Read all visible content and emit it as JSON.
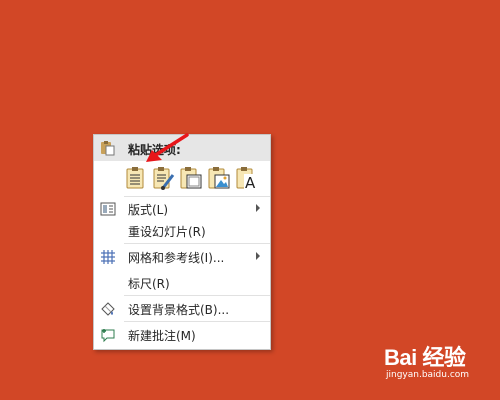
{
  "context_menu": {
    "paste_options_label": "粘贴选项:",
    "paste_options": [
      {
        "icon": "paste-destination-theme-icon"
      },
      {
        "icon": "paste-keep-formatting-icon"
      },
      {
        "icon": "paste-embed-icon"
      },
      {
        "icon": "paste-picture-icon"
      },
      {
        "icon": "paste-text-only-icon",
        "glyph": "A"
      }
    ],
    "items": [
      {
        "label": "版式(L)",
        "submenu": true
      },
      {
        "label": "重设幻灯片(R)"
      },
      {
        "label": "网格和参考线(I)...",
        "submenu": true
      },
      {
        "label": "标尺(R)"
      },
      {
        "label": "设置背景格式(B)..."
      },
      {
        "label": "新建批注(M)"
      }
    ]
  },
  "watermark": {
    "logo": "Bai 经验",
    "url": "jingyan.baidu.com"
  },
  "colors": {
    "background": "#D24726",
    "annotation_arrow": "#E8161A"
  }
}
